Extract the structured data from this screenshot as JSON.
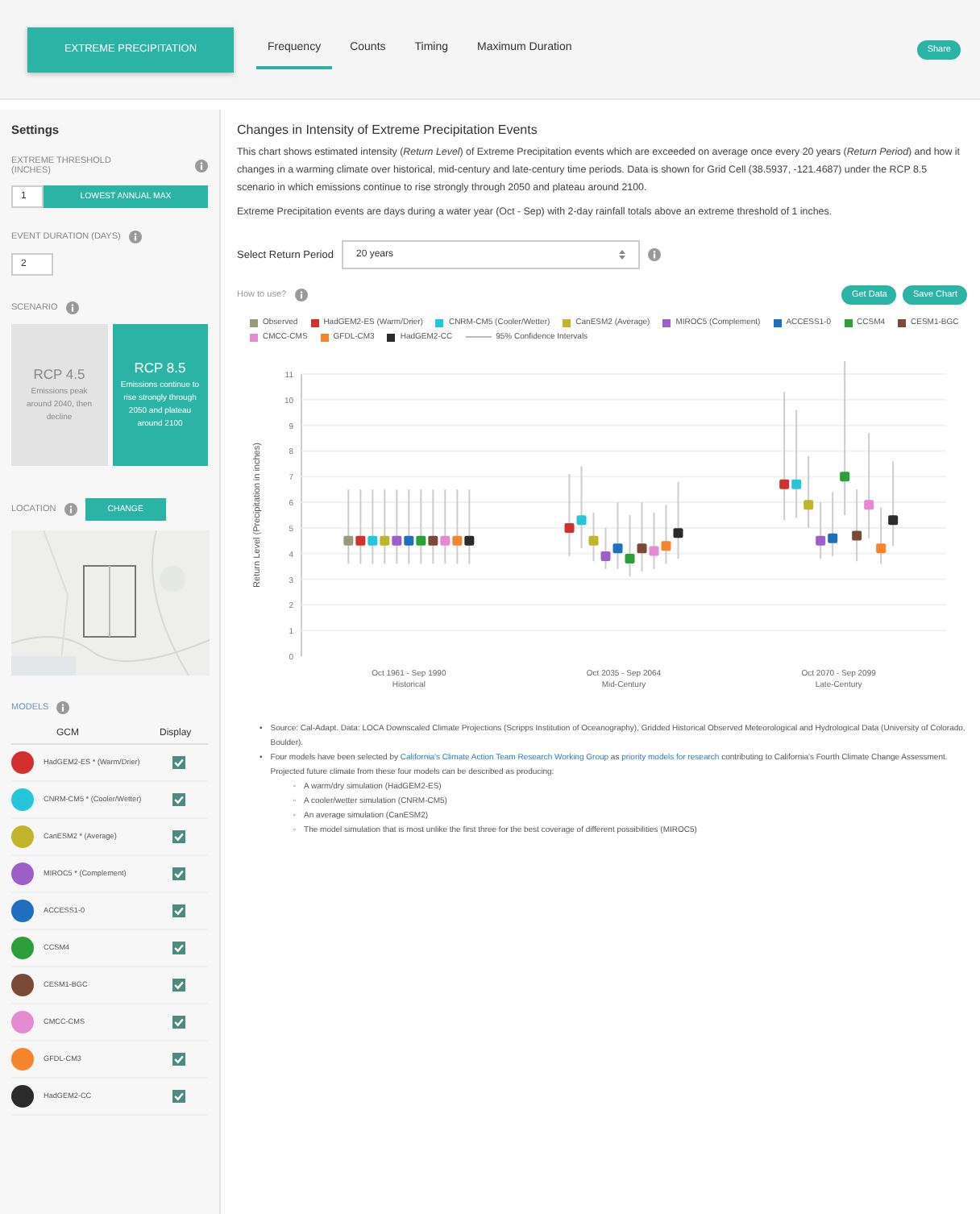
{
  "header": {
    "title_button": "EXTREME PRECIPITATION",
    "tabs": [
      {
        "label": "Frequency",
        "selected": true
      },
      {
        "label": "Counts",
        "selected": false
      },
      {
        "label": "Timing",
        "selected": false
      },
      {
        "label": "Maximum Duration",
        "selected": false
      }
    ],
    "share_button": "Share"
  },
  "settings": {
    "heading": "Settings",
    "threshold": {
      "label": "EXTREME THRESHOLD (INCHES)",
      "value": "1",
      "button": "LOWEST ANNUAL MAX"
    },
    "duration": {
      "label": "EVENT DURATION (DAYS)",
      "value": "2"
    },
    "scenario": {
      "label": "SCENARIO",
      "options": [
        {
          "title": "RCP 4.5",
          "text": "Emissions peak around 2040, then decline",
          "selected": false
        },
        {
          "title": "RCP 8.5",
          "text": "Emissions continue to rise strongly through 2050 and plateau around 2100",
          "selected": true
        }
      ]
    },
    "location": {
      "label": "LOCATION",
      "button": "CHANGE"
    },
    "models": {
      "label": "MODELS",
      "columns": [
        "GCM",
        "Display"
      ],
      "rows": [
        {
          "name": "HadGEM2-ES * (Warm/Drier)",
          "color": "#d32f2f",
          "checked": true
        },
        {
          "name": "CNRM-CM5 * (Cooler/Wetter)",
          "color": "#26c6da",
          "checked": true
        },
        {
          "name": "CanESM2 * (Average)",
          "color": "#c0b52a",
          "checked": true
        },
        {
          "name": "MIROC5 * (Complement)",
          "color": "#9c5fc7",
          "checked": true
        },
        {
          "name": "ACCESS1-0",
          "color": "#1f6fbf",
          "checked": true
        },
        {
          "name": "CCSM4",
          "color": "#2e9e3a",
          "checked": true
        },
        {
          "name": "CESM1-BGC",
          "color": "#7b4a36",
          "checked": true
        },
        {
          "name": "CMCC-CMS",
          "color": "#e48ad0",
          "checked": true
        },
        {
          "name": "GFDL-CM3",
          "color": "#f5842a",
          "checked": true
        },
        {
          "name": "HadGEM2-CC",
          "color": "#2b2b2b",
          "checked": true
        }
      ]
    }
  },
  "main": {
    "title": "Changes in Intensity of Extreme Precipitation Events",
    "paragraphs": [
      "This chart shows estimated intensity (*Return Level*) of Extreme Precipitation events which are exceeded on average once every 20 years (*Return Period*) and how it changes in a warming climate over historical, mid-century and late-century time periods. Data is shown for Grid Cell (38.5937, -121.4687) under the RCP 8.5 scenario in which emissions continue to rise strongly through 2050 and plateau around 2100.",
      "Extreme Precipitation events are days during a water year (Oct - Sep) with 2-day rainfall totals above an extreme threshold of 1 inches."
    ],
    "select": {
      "label": "Select Return Period",
      "value": "20 years"
    },
    "how_to_use": "How to use?",
    "buttons": [
      "Get Data",
      "Save Chart"
    ],
    "confidence_label": "95% Confidence Intervals",
    "category_names": [
      "Historical",
      "Mid-Century",
      "Late-Century"
    ],
    "chart_data": {
      "type": "scatter",
      "grid": true,
      "ylabel": "Return Level (Precipitation in inches)",
      "categories": [
        "Oct 1961 - Sep 1990",
        "Oct 2035 - Sep 2064",
        "Oct 2070 - Sep 2099"
      ],
      "ylim": [
        0,
        11
      ],
      "yticks": [
        0,
        1,
        2,
        3,
        4,
        5,
        6,
        7,
        8,
        9,
        10,
        11
      ],
      "series": [
        {
          "name": "Observed",
          "color": "#9a9a7a",
          "values": [
            4.5,
            null,
            null
          ],
          "errors": [
            [
              3.6,
              6.5
            ],
            null,
            null
          ]
        },
        {
          "name": "HadGEM2-ES (Warm/Drier)",
          "color": "#d32f2f",
          "values": [
            4.5,
            5.0,
            6.7
          ],
          "errors": [
            [
              3.6,
              6.5
            ],
            [
              3.9,
              7.1
            ],
            [
              5.3,
              10.3
            ]
          ]
        },
        {
          "name": "CNRM-CM5 (Cooler/Wetter)",
          "color": "#26c6da",
          "values": [
            4.5,
            5.3,
            6.7
          ],
          "errors": [
            [
              3.6,
              6.5
            ],
            [
              4.2,
              7.4
            ],
            [
              5.4,
              9.6
            ]
          ]
        },
        {
          "name": "CanESM2 (Average)",
          "color": "#c0b52a",
          "values": [
            4.5,
            4.5,
            5.9
          ],
          "errors": [
            [
              3.6,
              6.5
            ],
            [
              3.7,
              5.6
            ],
            [
              5.0,
              7.8
            ]
          ]
        },
        {
          "name": "MIROC5 (Complement)",
          "color": "#9c5fc7",
          "values": [
            4.5,
            3.9,
            4.5
          ],
          "errors": [
            [
              3.6,
              6.5
            ],
            [
              3.4,
              5.0
            ],
            [
              3.8,
              6.0
            ]
          ]
        },
        {
          "name": "ACCESS1-0",
          "color": "#1f6fbf",
          "values": [
            4.5,
            4.2,
            4.6
          ],
          "errors": [
            [
              3.6,
              6.5
            ],
            [
              3.4,
              6.0
            ],
            [
              3.9,
              6.4
            ]
          ]
        },
        {
          "name": "CCSM4",
          "color": "#2e9e3a",
          "values": [
            4.5,
            3.8,
            7.0
          ],
          "errors": [
            [
              3.6,
              6.5
            ],
            [
              3.1,
              5.5
            ],
            [
              5.5,
              11.5
            ]
          ]
        },
        {
          "name": "CESM1-BGC",
          "color": "#7b4a36",
          "values": [
            4.5,
            4.2,
            4.7
          ],
          "errors": [
            [
              3.6,
              6.5
            ],
            [
              3.3,
              6.0
            ],
            [
              3.7,
              6.5
            ]
          ]
        },
        {
          "name": "CMCC-CMS",
          "color": "#e48ad0",
          "values": [
            4.5,
            4.1,
            5.9
          ],
          "errors": [
            [
              3.6,
              6.5
            ],
            [
              3.4,
              5.6
            ],
            [
              4.6,
              8.7
            ]
          ]
        },
        {
          "name": "GFDL-CM3",
          "color": "#f5842a",
          "values": [
            4.5,
            4.3,
            4.2
          ],
          "errors": [
            [
              3.6,
              6.5
            ],
            [
              3.6,
              5.9
            ],
            [
              3.6,
              5.8
            ]
          ]
        },
        {
          "name": "HadGEM2-CC",
          "color": "#2b2b2b",
          "values": [
            4.5,
            4.8,
            5.3
          ],
          "errors": [
            [
              3.6,
              6.5
            ],
            [
              3.8,
              6.8
            ],
            [
              4.3,
              7.6
            ]
          ]
        }
      ]
    },
    "notes": [
      {
        "marker": "•",
        "segments": [
          {
            "kind": "text",
            "text": "Source: Cal-Adapt. Data: LOCA Downscaled Climate Projections (Scripps Institution of Oceanography), Gridded Historical Observed Meteorological and Hydrological Data (University of Colorado, Boulder)."
          }
        ]
      },
      {
        "marker": "•",
        "segments": [
          {
            "kind": "text",
            "text": "Four models have been selected by "
          },
          {
            "kind": "link",
            "text": "California's Climate Action Team Research Working Group"
          },
          {
            "kind": "text",
            "text": " as "
          },
          {
            "kind": "link",
            "text": "priority models for research"
          },
          {
            "kind": "text",
            "text": " contributing to California's Fourth Climate Change Assessment. Projected future climate from these four models can be described as producing:"
          }
        ],
        "children": [
          {
            "marker": "◦",
            "text": "A warm/dry simulation (HadGEM2-ES)"
          },
          {
            "marker": "◦",
            "text": "A cooler/wetter simulation (CNRM-CM5)"
          },
          {
            "marker": "◦",
            "text": "An average simulation (CanESM2)"
          },
          {
            "marker": "◦",
            "text": "The model simulation that is most unlike the first three for the best coverage of different possibilities (MIROC5)"
          }
        ]
      }
    ]
  }
}
